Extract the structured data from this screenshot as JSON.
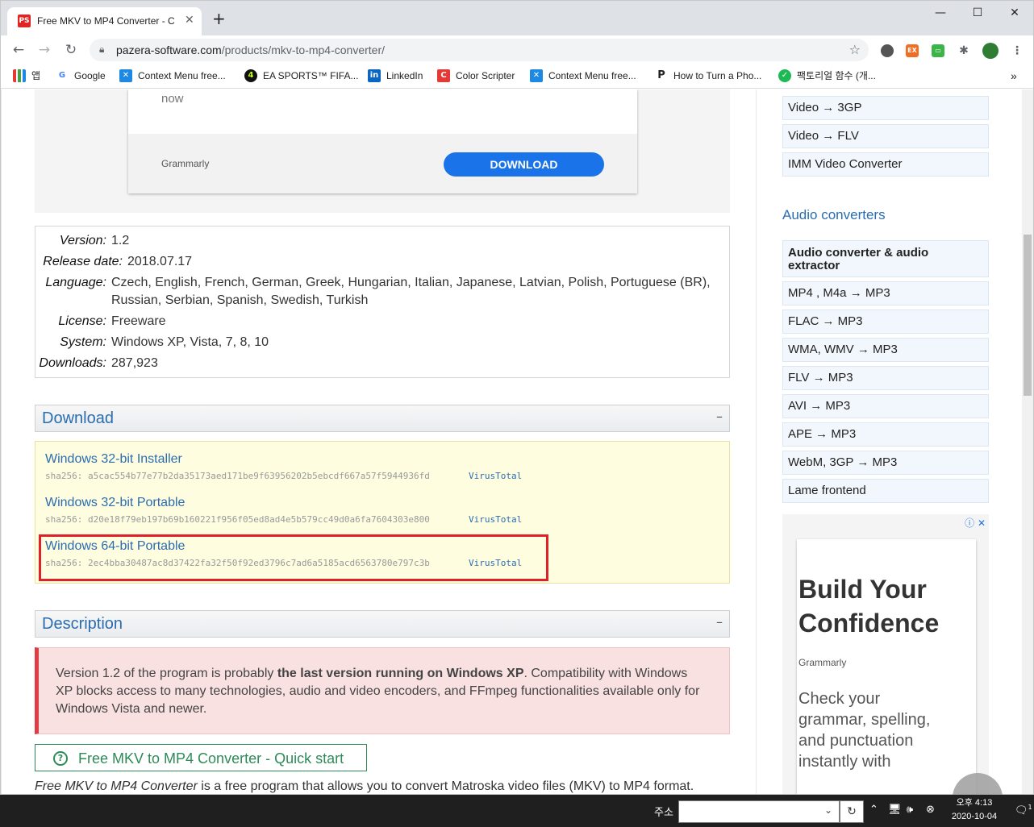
{
  "browser": {
    "tab_title": "Free MKV to MP4 Converter - C",
    "tab_favicon": "PS",
    "url_host": "pazera-software.com",
    "url_path": "/products/mkv-to-mp4-converter/",
    "window_controls": {
      "minimize": "—",
      "maximize": "☐",
      "close": "✕"
    }
  },
  "bookmarks": [
    {
      "label": "앱",
      "icon": "apps-grid-icon"
    },
    {
      "label": "Google",
      "icon": "google-icon"
    },
    {
      "label": "Context Menu free...",
      "icon": "context-menu-icon"
    },
    {
      "label": "EA SPORTS™ FIFA...",
      "icon": "ea-sports-icon"
    },
    {
      "label": "LinkedIn",
      "icon": "linkedin-icon"
    },
    {
      "label": "Color Scripter",
      "icon": "color-scripter-icon"
    },
    {
      "label": "Context Menu free...",
      "icon": "context-menu-icon"
    },
    {
      "label": "How to Turn a Pho...",
      "icon": "p-site-icon"
    },
    {
      "label": "팩토리얼 함수 (개...",
      "icon": "shield-site-icon"
    }
  ],
  "ad_top": {
    "text_now": "now",
    "brand": "Grammarly",
    "button": "DOWNLOAD"
  },
  "info": {
    "version_label": "Version:",
    "version": "1.2",
    "release_label": "Release date:",
    "release": "2018.07.17",
    "language_label": "Language:",
    "language_line1": "Czech, English, French, German, Greek, Hungarian, Italian, Japanese, Latvian, Polish, Portuguese (BR),",
    "language_line2": "Russian, Serbian, Spanish, Swedish, Turkish",
    "license_label": "License:",
    "license": "Freeware",
    "system_label": "System:",
    "system": "Windows XP, Vista, 7, 8, 10",
    "downloads_label": "Downloads:",
    "downloads": "287,923"
  },
  "download_section": {
    "title": "Download",
    "collapse": "–",
    "items": [
      {
        "label": "Windows 32-bit Installer",
        "sha": "sha256: a5cac554b77e77b2da35173aed171be9f63956202b5ebcdf667a57f5944936fd",
        "vt": "VirusTotal"
      },
      {
        "label": "Windows 32-bit Portable",
        "sha": "sha256: d20e18f79eb197b69b160221f956f05ed8ad4e5b579cc49d0a6fa7604303e800",
        "vt": "VirusTotal"
      },
      {
        "label": "Windows 64-bit Portable",
        "sha": "sha256: 2ec4bba30487ac8d37422fa32f50f92ed3796c7ad6a5185acd6563780e797c3b",
        "vt": "VirusTotal"
      }
    ]
  },
  "description_section": {
    "title": "Description",
    "collapse": "–",
    "warn_pre": "Version 1.2 of the program is probably ",
    "warn_bold": "the last version running on Windows XP",
    "warn_post": ". Compatibility with Windows XP blocks access to many technologies, audio and video encoders, and FFmpeg functionalities available only for Windows Vista and newer.",
    "quickstart": "Free MKV to MP4 Converter - Quick start",
    "intro_italic": "Free MKV to MP4 Converter",
    "intro_rest": " is a free program that allows you to convert Matroska video files (MKV) to MP4 format."
  },
  "sidebar": {
    "video_items": [
      "Video → 3GP",
      "Video → FLV",
      "IMM Video Converter"
    ],
    "audio_heading": "Audio converters",
    "audio_items": [
      "Audio converter & audio extractor",
      "MP4 , M4a → MP3",
      "FLAC → MP3",
      "WMA, WMV → MP3",
      "FLV → MP3",
      "AVI → MP3",
      "APE → MP3",
      "WebM, 3GP → MP3",
      "Lame frontend"
    ]
  },
  "ad_side": {
    "headline": "Build Your Confidence",
    "brand": "Grammarly",
    "body": "Check your grammar, spelling, and punctuation instantly with"
  },
  "taskbar": {
    "address_label": "주소",
    "time": "오후 4:13",
    "date": "2020-10-04",
    "notification_count": "1"
  },
  "colors": {
    "accent": "#2a6db0",
    "highlight": "#e0212a",
    "download_bg": "#fffde0",
    "warn_bg": "#f9e1e2"
  }
}
